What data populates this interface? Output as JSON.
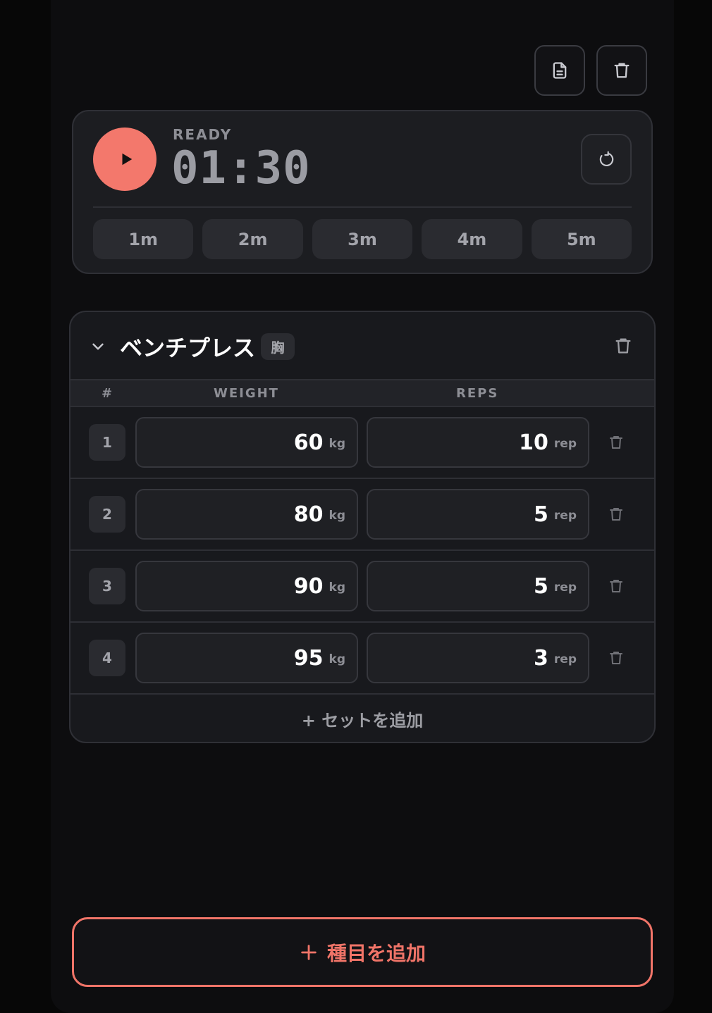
{
  "colors": {
    "accent": "#f3786c",
    "background": "#0d0d0f",
    "card": "#1c1d21"
  },
  "toolbar": {
    "notes_icon": "document-icon",
    "delete_icon": "trash-icon"
  },
  "timer": {
    "status": "READY",
    "time": "01:30",
    "presets": [
      "1m",
      "2m",
      "3m",
      "4m",
      "5m"
    ]
  },
  "exercise": {
    "name": "ベンチプレス",
    "tag": "胸",
    "columns": {
      "num": "#",
      "weight": "WEIGHT",
      "reps": "REPS"
    },
    "sets": [
      {
        "num": "1",
        "weight": "60",
        "weight_unit": "kg",
        "reps": "10",
        "reps_unit": "rep"
      },
      {
        "num": "2",
        "weight": "80",
        "weight_unit": "kg",
        "reps": "5",
        "reps_unit": "rep"
      },
      {
        "num": "3",
        "weight": "90",
        "weight_unit": "kg",
        "reps": "5",
        "reps_unit": "rep"
      },
      {
        "num": "4",
        "weight": "95",
        "weight_unit": "kg",
        "reps": "3",
        "reps_unit": "rep"
      }
    ],
    "add_set_label": "+ セットを追加"
  },
  "add_exercise_label": "種目を追加"
}
